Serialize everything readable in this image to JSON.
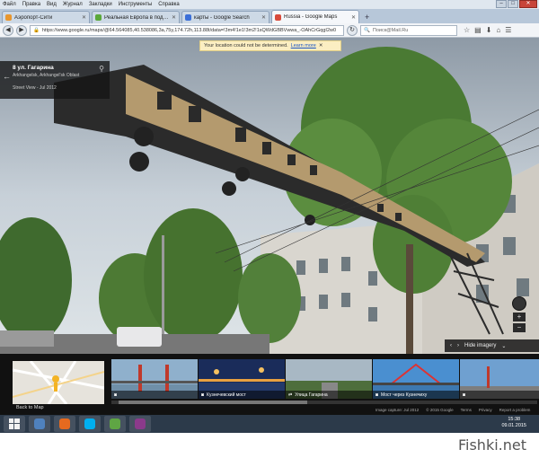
{
  "menu": {
    "items": [
      "Файл",
      "Правка",
      "Вид",
      "Журнал",
      "Закладки",
      "Инструменты",
      "Справка"
    ]
  },
  "window_controls": {
    "minimize": "–",
    "maximize": "□",
    "close": "✕"
  },
  "tabs": [
    {
      "label": "Аэропорт-Сити",
      "color": "#e8962e"
    },
    {
      "label": "Реальная Европа в подзем...",
      "color": "#5aa83a"
    },
    {
      "label": "карты - Google Search",
      "color": "#3b6fd8"
    },
    {
      "label": "Russia - Google Maps",
      "color": "#d84a3b",
      "active": true
    }
  ],
  "tab_new": "+",
  "nav": {
    "url": "https://www.google.ru/maps/@64.564085,40.538086,3a,75y,174.72h,113.88t/data=!3m4!1e1!3m2!1sQWdGBBVwwa_-OAhCrGqgI2w0",
    "search_placeholder": "Поиск@Mail.Ru"
  },
  "notice": {
    "text": "Your location could not be determined.",
    "link": "Learn more",
    "close": "✕"
  },
  "infocard": {
    "title": "8 ул. Гагарина",
    "subtitle": "Arkhangelsk, Arkhangel'sk Oblast",
    "streetview": "Street View - Jul 2012"
  },
  "controls": {
    "zoom_in": "+",
    "zoom_out": "−",
    "hide_imagery": "Hide imagery"
  },
  "minimap": {
    "back_label": "Back to Map"
  },
  "thumbs": [
    {
      "caption": ""
    },
    {
      "caption": "Кузнечевский мост"
    },
    {
      "caption": "Улица Гагарина"
    },
    {
      "caption": ""
    },
    {
      "caption": "Мост через Кузнечиху"
    },
    {
      "caption": ""
    }
  ],
  "footer": {
    "capture": "Image capture: Jul 2012",
    "copyright": "© 2015 Google",
    "terms": "Terms",
    "privacy": "Privacy",
    "report": "Report a problem"
  },
  "taskbar": {
    "apps": [
      {
        "name": "explorer",
        "color": "#4f81bd"
      },
      {
        "name": "firefox",
        "color": "#e66a1f"
      },
      {
        "name": "skype",
        "color": "#00aff0"
      },
      {
        "name": "mail",
        "color": "#5fa544"
      },
      {
        "name": "winrar",
        "color": "#8b3a8b"
      }
    ],
    "time": "15:38",
    "date": "09.01.2015"
  },
  "watermark": "Fishki.net"
}
